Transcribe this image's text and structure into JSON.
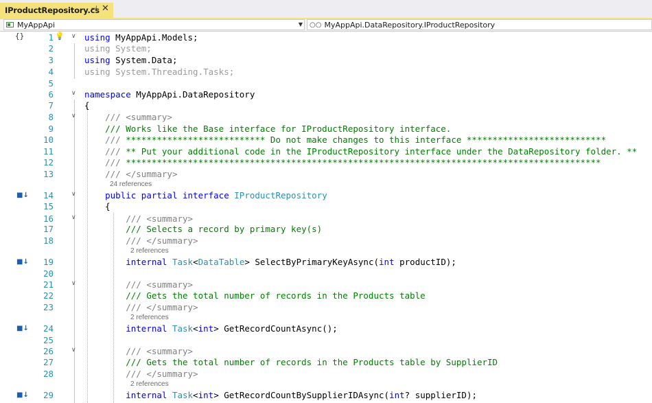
{
  "tab": {
    "title": "IProductRepository.cs",
    "pin": "⊣",
    "close": "✕"
  },
  "navbar": {
    "project": "MyAppApi",
    "scope": "MyAppApi.DataRepository.IProductRepository"
  },
  "icons": {
    "pin": "pin-icon",
    "close": "close-icon",
    "lightbulb": "lightbulb-icon",
    "implements": "implements-interface-icon",
    "collapse": "chevron-down-icon"
  },
  "lines": [
    {
      "num": "1",
      "tokens": [
        {
          "t": "using",
          "c": "kw"
        },
        {
          "t": " MyAppApi.Models;",
          "c": ""
        }
      ]
    },
    {
      "num": "2",
      "tokens": [
        {
          "t": "using System;",
          "c": "faded"
        }
      ]
    },
    {
      "num": "3",
      "tokens": [
        {
          "t": "using",
          "c": "kw"
        },
        {
          "t": " System.Data;",
          "c": ""
        }
      ]
    },
    {
      "num": "4",
      "tokens": [
        {
          "t": "using System.Threading.Tasks;",
          "c": "faded"
        }
      ]
    },
    {
      "num": "5",
      "tokens": []
    },
    {
      "num": "6",
      "tokens": [
        {
          "t": "namespace",
          "c": "kw"
        },
        {
          "t": " MyAppApi.DataRepository",
          "c": ""
        }
      ]
    },
    {
      "num": "7",
      "tokens": [
        {
          "t": "{",
          "c": ""
        }
      ]
    },
    {
      "num": "8",
      "tokens": [
        {
          "t": "    ",
          "c": ""
        },
        {
          "t": "/// ",
          "c": "xd"
        },
        {
          "t": "<summary>",
          "c": "xd"
        }
      ]
    },
    {
      "num": "9",
      "tokens": [
        {
          "t": "    ",
          "c": ""
        },
        {
          "t": "/// Works like the Base interface for IProductRepository interface.",
          "c": "cm"
        }
      ]
    },
    {
      "num": "10",
      "tokens": [
        {
          "t": "    ",
          "c": ""
        },
        {
          "t": "/// ",
          "c": "xd"
        },
        {
          "t": "*************************** Do not make changes to this interface ***************************",
          "c": "cm"
        }
      ]
    },
    {
      "num": "11",
      "tokens": [
        {
          "t": "    ",
          "c": ""
        },
        {
          "t": "/// ",
          "c": "xd"
        },
        {
          "t": "** Put your additional code in the IProductRepository interface under the DataRepository folder. **",
          "c": "cm"
        }
      ]
    },
    {
      "num": "12",
      "tokens": [
        {
          "t": "    ",
          "c": ""
        },
        {
          "t": "/// ",
          "c": "xd"
        },
        {
          "t": "********************************************************************************************",
          "c": "cm"
        }
      ]
    },
    {
      "num": "13",
      "tokens": [
        {
          "t": "    ",
          "c": ""
        },
        {
          "t": "/// ",
          "c": "xd"
        },
        {
          "t": "</summary>",
          "c": "xd"
        }
      ]
    },
    {
      "num": "14",
      "tokens": [
        {
          "t": "    ",
          "c": ""
        },
        {
          "t": "public partial interface",
          "c": "kw"
        },
        {
          "t": " ",
          "c": ""
        },
        {
          "t": "IProductRepository",
          "c": "ty"
        }
      ]
    },
    {
      "num": "15",
      "tokens": [
        {
          "t": "    {",
          "c": ""
        }
      ]
    },
    {
      "num": "16",
      "tokens": [
        {
          "t": "        ",
          "c": ""
        },
        {
          "t": "/// ",
          "c": "xd"
        },
        {
          "t": "<summary>",
          "c": "xd"
        }
      ]
    },
    {
      "num": "17",
      "tokens": [
        {
          "t": "        ",
          "c": ""
        },
        {
          "t": "/// Selects a record by primary key(s)",
          "c": "cm"
        }
      ]
    },
    {
      "num": "18",
      "tokens": [
        {
          "t": "        ",
          "c": ""
        },
        {
          "t": "/// ",
          "c": "xd"
        },
        {
          "t": "</summary>",
          "c": "xd"
        }
      ]
    },
    {
      "num": "19",
      "tokens": [
        {
          "t": "        ",
          "c": ""
        },
        {
          "t": "internal",
          "c": "kw"
        },
        {
          "t": " ",
          "c": ""
        },
        {
          "t": "Task",
          "c": "ty"
        },
        {
          "t": "<",
          "c": ""
        },
        {
          "t": "DataTable",
          "c": "ty"
        },
        {
          "t": "> SelectByPrimaryKeyAsync(",
          "c": ""
        },
        {
          "t": "int",
          "c": "kw"
        },
        {
          "t": " productID);",
          "c": ""
        }
      ]
    },
    {
      "num": "20",
      "tokens": []
    },
    {
      "num": "21",
      "tokens": [
        {
          "t": "        ",
          "c": ""
        },
        {
          "t": "/// ",
          "c": "xd"
        },
        {
          "t": "<summary>",
          "c": "xd"
        }
      ]
    },
    {
      "num": "22",
      "tokens": [
        {
          "t": "        ",
          "c": ""
        },
        {
          "t": "/// Gets the total number of records in the Products table",
          "c": "cm"
        }
      ]
    },
    {
      "num": "23",
      "tokens": [
        {
          "t": "        ",
          "c": ""
        },
        {
          "t": "/// ",
          "c": "xd"
        },
        {
          "t": "</summary>",
          "c": "xd"
        }
      ]
    },
    {
      "num": "24",
      "tokens": [
        {
          "t": "        ",
          "c": ""
        },
        {
          "t": "internal",
          "c": "kw"
        },
        {
          "t": " ",
          "c": ""
        },
        {
          "t": "Task",
          "c": "ty"
        },
        {
          "t": "<",
          "c": ""
        },
        {
          "t": "int",
          "c": "kw"
        },
        {
          "t": "> GetRecordCountAsync();",
          "c": ""
        }
      ]
    },
    {
      "num": "25",
      "tokens": []
    },
    {
      "num": "26",
      "tokens": [
        {
          "t": "        ",
          "c": ""
        },
        {
          "t": "/// ",
          "c": "xd"
        },
        {
          "t": "<summary>",
          "c": "xd"
        }
      ]
    },
    {
      "num": "27",
      "tokens": [
        {
          "t": "        ",
          "c": ""
        },
        {
          "t": "/// Gets the total number of records in the Products table by SupplierID",
          "c": "cm"
        }
      ]
    },
    {
      "num": "28",
      "tokens": [
        {
          "t": "        ",
          "c": ""
        },
        {
          "t": "/// ",
          "c": "xd"
        },
        {
          "t": "</summary>",
          "c": "xd"
        }
      ]
    },
    {
      "num": "29",
      "tokens": [
        {
          "t": "        ",
          "c": ""
        },
        {
          "t": "internal",
          "c": "kw"
        },
        {
          "t": " ",
          "c": ""
        },
        {
          "t": "Task",
          "c": "ty"
        },
        {
          "t": "<",
          "c": ""
        },
        {
          "t": "int",
          "c": "kw"
        },
        {
          "t": "> GetRecordCountBySupplierIDAsync(",
          "c": ""
        },
        {
          "t": "int",
          "c": "kw"
        },
        {
          "t": "? supplierID);",
          "c": ""
        }
      ]
    }
  ],
  "references": [
    {
      "label": "24 references"
    },
    {
      "label": "2 references"
    },
    {
      "label": "2 references"
    },
    {
      "label": "2 references"
    }
  ],
  "colors": {
    "keyword": "#0000ff",
    "type": "#2b91af",
    "comment": "#008000",
    "xmldoc": "#808080",
    "lineNumber": "#2b91af",
    "tabActive": "#f6e27a"
  }
}
